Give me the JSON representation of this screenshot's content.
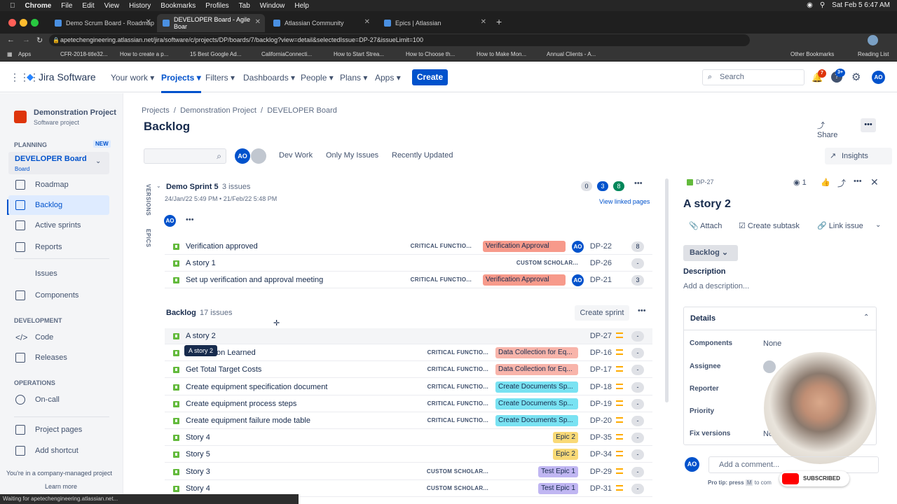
{
  "mac": {
    "menu": [
      "Chrome",
      "File",
      "Edit",
      "View",
      "History",
      "Bookmarks",
      "Profiles",
      "Tab",
      "Window",
      "Help"
    ],
    "clock": "Sat Feb 5  6:47 AM"
  },
  "browser": {
    "tabs": [
      {
        "label": "Demo Scrum Board - Roadmap"
      },
      {
        "label": "DEVELOPER Board - Agile Boar"
      },
      {
        "label": "Atlassian Community"
      },
      {
        "label": "Epics | Atlassian"
      }
    ],
    "url": "apetechengineering.atlassian.net/jira/software/c/projects/DP/boards/7/backlog?view=detail&selectedIssue=DP-27&issueLimit=100",
    "bookmarks": [
      "Apps",
      "CFR-2018-title32...",
      "How to create a p...",
      "15 Best Google Ad...",
      "CaliforniaConnecti...",
      "How to Start Strea...",
      "How to Choose th...",
      "How to Make Mon...",
      "Annual Clients - A...",
      "Other Bookmarks",
      "Reading List"
    ],
    "status": "Waiting for apetechengineering.atlassian.net..."
  },
  "nav": {
    "logo": "Jira Software",
    "items": [
      "Your work",
      "Projects",
      "Filters",
      "Dashboards",
      "People",
      "Plans",
      "Apps"
    ],
    "create": "Create",
    "search_placeholder": "Search",
    "notif_count": "7",
    "help_count": "3+",
    "user_initials": "AO"
  },
  "sidebar": {
    "project_name": "Demonstration Project",
    "project_type": "Software project",
    "planning": "PLANNING",
    "new_badge": "NEW",
    "board_name": "DEVELOPER Board",
    "board_sub": "Board",
    "items": [
      "Roadmap",
      "Backlog",
      "Active sprints",
      "Reports",
      "Issues",
      "Components"
    ],
    "development": "DEVELOPMENT",
    "dev_items": [
      "Code",
      "Releases"
    ],
    "operations": "OPERATIONS",
    "ops_items": [
      "On-call"
    ],
    "footer_items": [
      "Project pages",
      "Add shortcut"
    ],
    "managed_note": "You're in a company-managed project",
    "learn_more": "Learn more"
  },
  "main": {
    "breadcrumb": [
      "Projects",
      "/",
      "Demonstration Project",
      "/",
      "DEVELOPER Board"
    ],
    "title": "Backlog",
    "share": "Share",
    "insights": "Insights",
    "filters": [
      "Dev Work",
      "Only My Issues",
      "Recently Updated"
    ],
    "side_tabs": [
      "VERSIONS",
      "EPICS"
    ],
    "sprint": {
      "name": "Demo Sprint 5",
      "count": "3 issues",
      "dates": "24/Jan/22 5:49 PM  •  21/Feb/22 5:48 PM",
      "counts": [
        "0",
        "3",
        "8"
      ],
      "view_linked": "View linked pages",
      "avatar": "AO",
      "rows": [
        {
          "title": "Verification approved",
          "label": "CRITICAL FUNCTIO...",
          "epic": "Verification Approval",
          "epic_color": "#f79a8b",
          "assignee": "AO",
          "key": "DP-22",
          "est": "8"
        },
        {
          "title": "A story 1",
          "label": "CUSTOM SCHOLAR...",
          "epic": "",
          "epic_color": "",
          "assignee": "",
          "key": "DP-26",
          "est": "-"
        },
        {
          "title": "Set up verification and approval meeting",
          "label": "CRITICAL FUNCTIO...",
          "epic": "Verification Approval",
          "epic_color": "#f79a8b",
          "assignee": "AO",
          "key": "DP-21",
          "est": "3"
        }
      ]
    },
    "backlog": {
      "name": "Backlog",
      "count": "17 issues",
      "create_sprint": "Create sprint",
      "tooltip": "A story 2",
      "rows": [
        {
          "title": "A story 2",
          "label": "",
          "epic": "",
          "epic_color": "",
          "key": "DP-27",
          "est": "-"
        },
        {
          "title": "Get Lesson Learned",
          "label": "CRITICAL FUNCTIO...",
          "epic": "Data Collection for Eq...",
          "epic_color": "#f8b4aa",
          "key": "DP-16",
          "est": "-"
        },
        {
          "title": "Get Total Target Costs",
          "label": "CRITICAL FUNCTIO...",
          "epic": "Data Collection for Eq...",
          "epic_color": "#f8b4aa",
          "key": "DP-17",
          "est": "-"
        },
        {
          "title": "Create equipment specification document",
          "label": "CRITICAL FUNCTIO...",
          "epic": "Create Documents Sp...",
          "epic_color": "#79e2f2",
          "key": "DP-18",
          "est": "-"
        },
        {
          "title": "Create equipment process steps",
          "label": "CRITICAL FUNCTIO...",
          "epic": "Create Documents Sp...",
          "epic_color": "#79e2f2",
          "key": "DP-19",
          "est": "-"
        },
        {
          "title": "Create equipment failure mode table",
          "label": "CRITICAL FUNCTIO...",
          "epic": "Create Documents Sp...",
          "epic_color": "#79e2f2",
          "key": "DP-20",
          "est": "-"
        },
        {
          "title": "Story 4",
          "label": "",
          "epic": "Epic 2",
          "epic_color": "#f9d976",
          "key": "DP-35",
          "est": "-"
        },
        {
          "title": "Story 5",
          "label": "",
          "epic": "Epic 2",
          "epic_color": "#f9d976",
          "key": "DP-34",
          "est": "-"
        },
        {
          "title": "Story 3",
          "label": "CUSTOM SCHOLAR...",
          "epic": "Test Epic 1",
          "epic_color": "#c0b6f2",
          "key": "DP-29",
          "est": "-"
        },
        {
          "title": "Story 4",
          "label": "CUSTOM SCHOLAR...",
          "epic": "Test Epic 1",
          "epic_color": "#c0b6f2",
          "key": "DP-31",
          "est": "-"
        }
      ]
    }
  },
  "panel": {
    "key": "DP-27",
    "watchers": "1",
    "title": "A story 2",
    "attach": "Attach",
    "create_subtask": "Create subtask",
    "link_issue": "Link issue",
    "status": "Backlog",
    "description_label": "Description",
    "description_placeholder": "Add a description...",
    "details": "Details",
    "fields": [
      {
        "label": "Components",
        "value": "None"
      },
      {
        "label": "Assignee",
        "value": ""
      },
      {
        "label": "Reporter",
        "value": ""
      },
      {
        "label": "Priority",
        "value": ""
      },
      {
        "label": "Fix versions",
        "value": "No"
      }
    ],
    "comment_placeholder": "Add a comment...",
    "protip": "Pro tip: press",
    "protip_key": "M",
    "protip_end": "to com",
    "subscribed": "SUBSCRIBED"
  }
}
